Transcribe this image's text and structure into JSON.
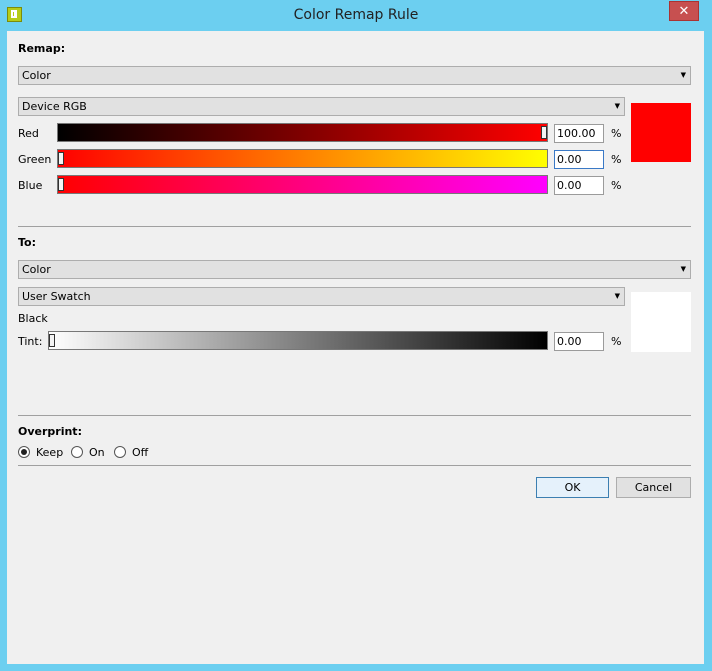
{
  "window": {
    "title": "Color Remap Rule",
    "close_label": "✕"
  },
  "remap": {
    "heading": "Remap:",
    "type": "Color",
    "space": "Device RGB",
    "preview_color": "#ff0000",
    "channels": [
      {
        "label": "Red",
        "value": "100.00",
        "level": 1.0
      },
      {
        "label": "Green",
        "value": "0.00",
        "level": 0.0
      },
      {
        "label": "Blue",
        "value": "0.00",
        "level": 0.0
      }
    ],
    "unit": "%"
  },
  "to": {
    "heading": "To:",
    "type": "Color",
    "space": "User Swatch",
    "swatch_name": "Black",
    "tint_label": "Tint:",
    "tint_value": "0.00",
    "tint_level": 0.0,
    "unit": "%",
    "preview_color": "#ffffff"
  },
  "overprint": {
    "heading": "Overprint:",
    "options": [
      {
        "label": "Keep",
        "checked": true
      },
      {
        "label": "On",
        "checked": false
      },
      {
        "label": "Off",
        "checked": false
      }
    ]
  },
  "buttons": {
    "ok": "OK",
    "cancel": "Cancel"
  }
}
